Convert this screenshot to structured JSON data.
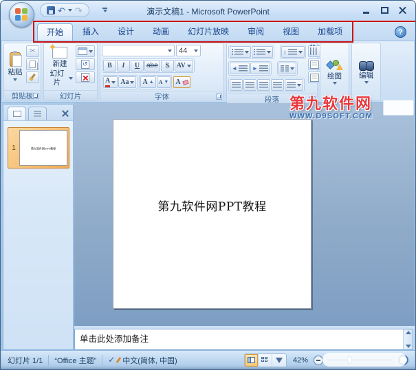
{
  "window": {
    "title": "演示文稿1 - Microsoft PowerPoint"
  },
  "icons": {
    "help": "?",
    "check": "✓",
    "scissors": "✂",
    "undo": "↶",
    "redo": "↷",
    "sparkle": "✦"
  },
  "tabs": [
    {
      "label": "开始",
      "active": true
    },
    {
      "label": "插入"
    },
    {
      "label": "设计"
    },
    {
      "label": "动画"
    },
    {
      "label": "幻灯片放映"
    },
    {
      "label": "审阅"
    },
    {
      "label": "视图"
    },
    {
      "label": "加载项"
    }
  ],
  "ribbon": {
    "clipboard": {
      "label": "剪贴板",
      "paste": "粘贴"
    },
    "slides": {
      "label": "幻灯片",
      "new_slide_line1": "新建",
      "new_slide_line2": "幻灯片"
    },
    "font": {
      "label": "字体",
      "font_name": "",
      "font_size": "44",
      "bold": "B",
      "italic": "I",
      "underline": "U",
      "strikethrough": "abe",
      "shadow": "S",
      "char_spacing": "AV",
      "font_color": "A",
      "change_case": "Aa",
      "grow_font": "A",
      "shrink_font": "A",
      "clear_format": "A"
    },
    "paragraph": {
      "label": "段落"
    },
    "drawing": {
      "label": "绘图"
    },
    "editing": {
      "label": "编辑"
    }
  },
  "watermark": {
    "line1": "第九软件网",
    "line2": "WWW.D9SOFT.COM",
    "line1_color": "#e8383d",
    "line2_color": "#3a72b0"
  },
  "slides_panel": {
    "slide_number": "1"
  },
  "slide": {
    "title": "第九软件网PPT教程"
  },
  "notes": {
    "placeholder": "单击此处添加备注"
  },
  "status": {
    "slide_indicator": "幻灯片 1/1",
    "theme": "“Office 主题”",
    "language": "中文(简体, 中国)",
    "zoom_level": "42%"
  }
}
